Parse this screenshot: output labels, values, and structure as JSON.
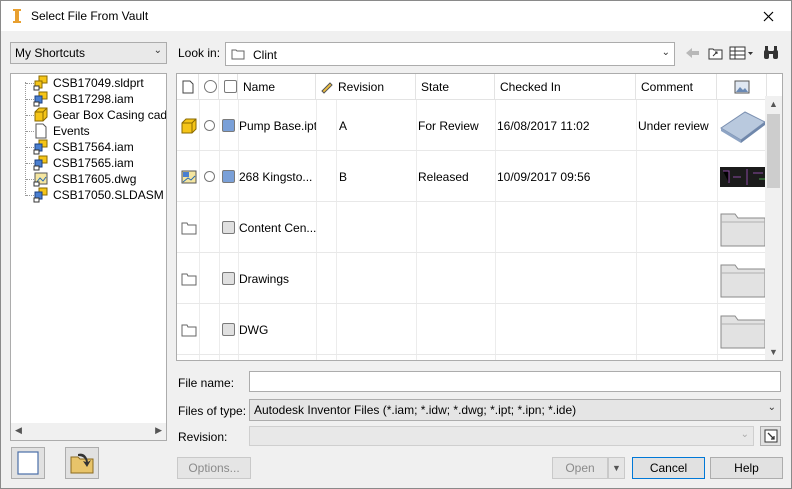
{
  "window": {
    "title": "Select File From Vault"
  },
  "shortcuts": {
    "selected": "My Shortcuts"
  },
  "tree": {
    "items": [
      {
        "label": "CSB17049.sldprt",
        "icon": "part-assembly-icon"
      },
      {
        "label": "CSB17298.iam",
        "icon": "assembly-icon"
      },
      {
        "label": "Gear Box Casing cad.ipt",
        "icon": "part-icon"
      },
      {
        "label": "Events",
        "icon": "document-icon"
      },
      {
        "label": "CSB17564.iam",
        "icon": "assembly-icon"
      },
      {
        "label": "CSB17565.iam",
        "icon": "assembly-icon"
      },
      {
        "label": "CSB17605.dwg",
        "icon": "drawing-icon"
      },
      {
        "label": "CSB17050.SLDASM",
        "icon": "assembly-icon"
      }
    ]
  },
  "lookin": {
    "label": "Look in:",
    "value": "Clint"
  },
  "grid": {
    "columns": {
      "name": "Name",
      "revision": "Revision",
      "state": "State",
      "checked_in": "Checked In",
      "comment": "Comment"
    },
    "rows": [
      {
        "type": "part",
        "name": "Pump Base.ipt",
        "revision": "A",
        "state": "For Review",
        "checked_in": "16/08/2017 11:02",
        "comment": "Under review",
        "thumb": "plate"
      },
      {
        "type": "drawing",
        "name": "268 Kingsto...",
        "revision": "B",
        "state": "Released",
        "checked_in": "10/09/2017 09:56",
        "comment": "",
        "thumb": "dark"
      },
      {
        "type": "folder",
        "name": "Content Cen...",
        "revision": "",
        "state": "",
        "checked_in": "",
        "comment": "",
        "thumb": "folder"
      },
      {
        "type": "folder",
        "name": "Drawings",
        "revision": "",
        "state": "",
        "checked_in": "",
        "comment": "",
        "thumb": "folder"
      },
      {
        "type": "folder",
        "name": "DWG",
        "revision": "",
        "state": "",
        "checked_in": "",
        "comment": "",
        "thumb": "folder"
      }
    ]
  },
  "form": {
    "file_name_label": "File name:",
    "file_name_value": "",
    "file_type_label": "Files of type:",
    "file_type_value": "Autodesk Inventor Files (*.iam; *.idw; *.dwg; *.ipt; *.ipn; *.ide)",
    "revision_label": "Revision:",
    "revision_value": ""
  },
  "buttons": {
    "options": "Options...",
    "open": "Open",
    "cancel": "Cancel",
    "help": "Help"
  },
  "colors": {
    "accent": "#0078d7",
    "part_yellow": "#f5c518",
    "state_blue": "#7aa0d8"
  }
}
